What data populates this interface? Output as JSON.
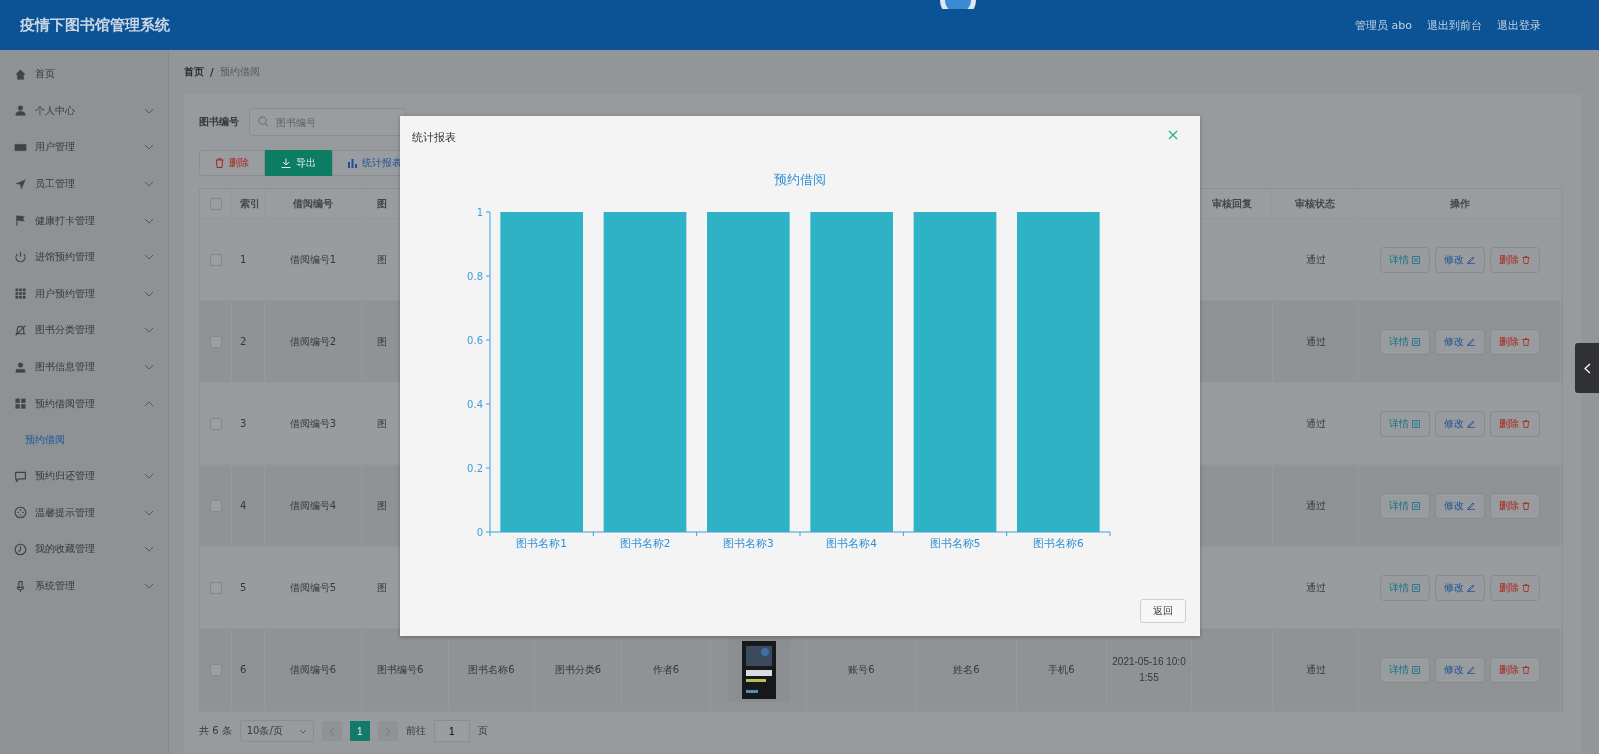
{
  "header": {
    "title": "疫情下图书馆管理系统",
    "user": "管理员 abo",
    "links": [
      "退出到前台",
      "退出登录"
    ]
  },
  "sidebar": {
    "items": [
      {
        "label": "首页",
        "expandable": false
      },
      {
        "label": "个人中心",
        "expandable": true,
        "expanded": false
      },
      {
        "label": "用户管理",
        "expandable": true,
        "expanded": false
      },
      {
        "label": "员工管理",
        "expandable": true,
        "expanded": false
      },
      {
        "label": "健康打卡管理",
        "expandable": true,
        "expanded": false
      },
      {
        "label": "进馆预约管理",
        "expandable": true,
        "expanded": false
      },
      {
        "label": "用户预约管理",
        "expandable": true,
        "expanded": false
      },
      {
        "label": "图书分类管理",
        "expandable": true,
        "expanded": false
      },
      {
        "label": "图书信息管理",
        "expandable": true,
        "expanded": false
      },
      {
        "label": "预约借阅管理",
        "expandable": true,
        "expanded": true,
        "children": [
          {
            "label": "预约借阅",
            "selected": true
          }
        ]
      },
      {
        "label": "预约归还管理",
        "expandable": true,
        "expanded": false
      },
      {
        "label": "温馨提示管理",
        "expandable": true,
        "expanded": false
      },
      {
        "label": "我的收藏管理",
        "expandable": true,
        "expanded": false
      },
      {
        "label": "系统管理",
        "expandable": true,
        "expanded": false
      }
    ]
  },
  "breadcrumb": {
    "items": [
      "首页",
      "预约借阅"
    ],
    "separator": "/"
  },
  "filters": [
    {
      "label": "图书编号",
      "placeholder": "图书编号"
    }
  ],
  "actions": [
    {
      "label": "删除",
      "kind": "danger"
    },
    {
      "label": "导出",
      "kind": "primary"
    },
    {
      "label": "统计报表",
      "kind": "chart"
    }
  ],
  "table": {
    "all_checked": false,
    "columns": [
      "索引",
      "借阅编号",
      "图",
      null,
      null,
      null,
      null,
      null,
      null,
      null,
      null,
      "审核回复",
      "审核状态",
      "操作"
    ],
    "rows": [
      {
        "checked": false,
        "cells": [
          "1",
          "借阅编号1",
          "图",
          null,
          null,
          null,
          null,
          null,
          null,
          null,
          null,
          null,
          "通过"
        ],
        "ops": [
          "详情",
          "修改",
          "删除"
        ]
      },
      {
        "checked": false,
        "cells": [
          "2",
          "借阅编号2",
          "图",
          null,
          null,
          null,
          null,
          null,
          null,
          null,
          null,
          null,
          "通过"
        ],
        "ops": [
          "详情",
          "修改",
          "删除"
        ]
      },
      {
        "checked": false,
        "cells": [
          "3",
          "借阅编号3",
          "图",
          null,
          null,
          null,
          null,
          null,
          null,
          null,
          null,
          null,
          "通过"
        ],
        "ops": [
          "详情",
          "修改",
          "删除"
        ]
      },
      {
        "checked": false,
        "cells": [
          "4",
          "借阅编号4",
          "图",
          null,
          null,
          null,
          null,
          null,
          null,
          null,
          null,
          null,
          "通过"
        ],
        "ops": [
          "详情",
          "修改",
          "删除"
        ]
      },
      {
        "checked": false,
        "cells": [
          "5",
          "借阅编号5",
          "图",
          null,
          null,
          null,
          null,
          null,
          null,
          null,
          null,
          null,
          "通过"
        ],
        "ops": [
          "详情",
          "修改",
          "删除"
        ]
      },
      {
        "checked": false,
        "cells": [
          "6",
          "借阅编号6",
          "图书编号6",
          "图书名称6",
          "图书分类6",
          "作者6",
          {
            "kind": "picture"
          },
          "账号6",
          "姓名6",
          "手机6",
          "2021-05-16 10:01:55",
          null,
          "通过"
        ],
        "ops": [
          "详情",
          "修改",
          "删除"
        ]
      }
    ]
  },
  "pagination": {
    "total": "共 6 条",
    "page_size": "10条/页",
    "pages": [
      {
        "label": "1",
        "selected": true
      }
    ],
    "goto_label": "前往",
    "goto_value": "1",
    "page_suffix": "页"
  },
  "dialog": {
    "title": "统计报表",
    "button": "返回",
    "chart_data": {
      "type": "bar",
      "title": "预约借阅",
      "categories": [
        "图书名称1",
        "图书名称2",
        "图书名称3",
        "图书名称4",
        "图书名称5",
        "图书名称6"
      ],
      "series": [
        {
          "color": "#2eb3c6",
          "values": [
            1,
            1,
            1,
            1,
            1,
            1
          ]
        }
      ],
      "ylim": [
        0,
        1
      ],
      "yticks": [
        0,
        0.2,
        0.4,
        0.6,
        0.8,
        1
      ]
    }
  }
}
